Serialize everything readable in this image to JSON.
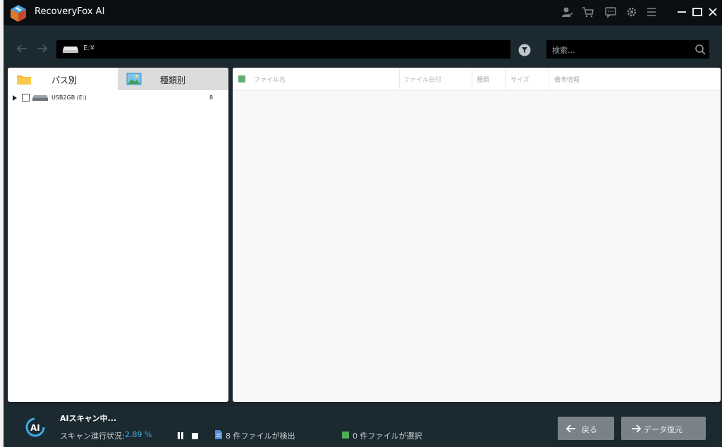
{
  "app": {
    "title": "RecoveryFox AI"
  },
  "toolbar": {
    "path": "E:¥",
    "search_placeholder": "検索..."
  },
  "left_panel": {
    "tabs": [
      {
        "label": "パス別"
      },
      {
        "label": "種類別"
      }
    ],
    "tree": [
      {
        "label": "USB2GB (E:)",
        "count": "8"
      }
    ]
  },
  "table": {
    "columns": [
      "ファイル名",
      "ファイル日付",
      "種類",
      "サイズ",
      "備考情報"
    ]
  },
  "footer": {
    "scan_title": "AIスキャン中...",
    "progress_label": "スキャン進行状況:",
    "progress_value": "2.89 %",
    "found_text": "8 件ファイルが検出",
    "selected_text": "0 件ファイルが選択",
    "back_label": "戻る",
    "recover_label": "データ復元"
  },
  "colors": {
    "accent": "#3fa9e6",
    "check_green": "#4caf50",
    "bg_dark": "#1b2a30",
    "titlebar": "#0b0f12"
  }
}
